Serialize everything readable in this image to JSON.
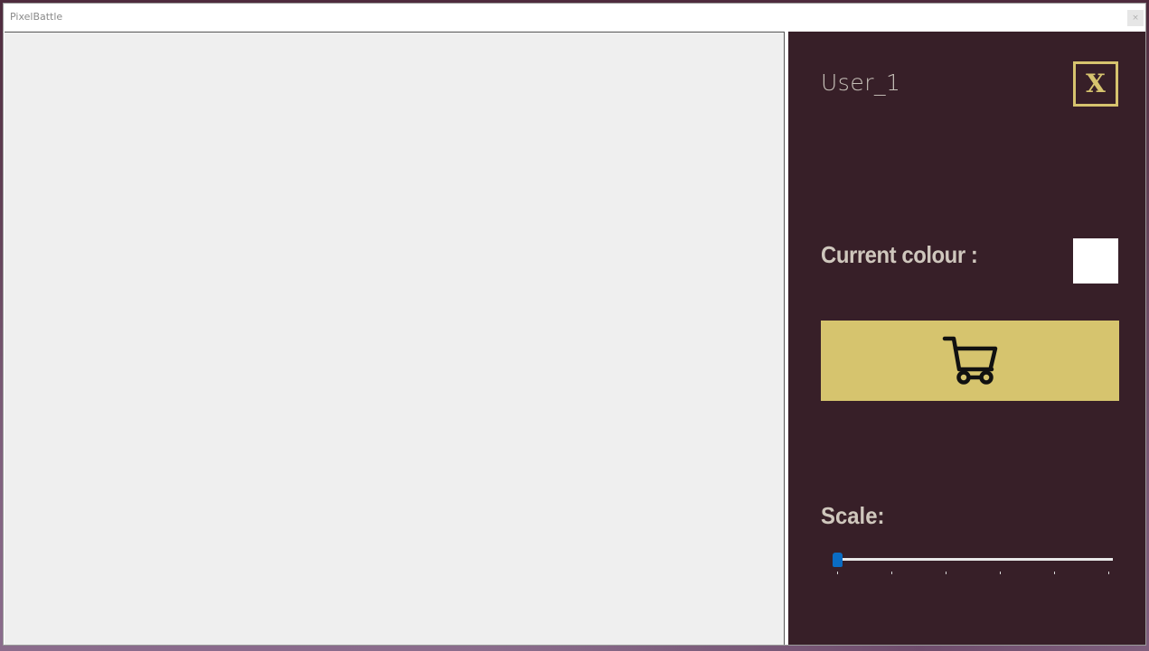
{
  "window": {
    "title": "PixelBattle",
    "close_glyph": "×"
  },
  "panel": {
    "username": "User_1",
    "close_label": "X",
    "current_colour_label": "Current colour :",
    "current_colour": "#ffffff",
    "shop_icon": "cart-icon",
    "scale_label": "Scale:",
    "scale": {
      "min": 0,
      "max": 5,
      "value": 0
    }
  },
  "colors": {
    "panel_bg": "#371f28",
    "accent": "#d6c46e",
    "canvas_bg": "#efefef",
    "slider_accent": "#0a6cc4"
  }
}
